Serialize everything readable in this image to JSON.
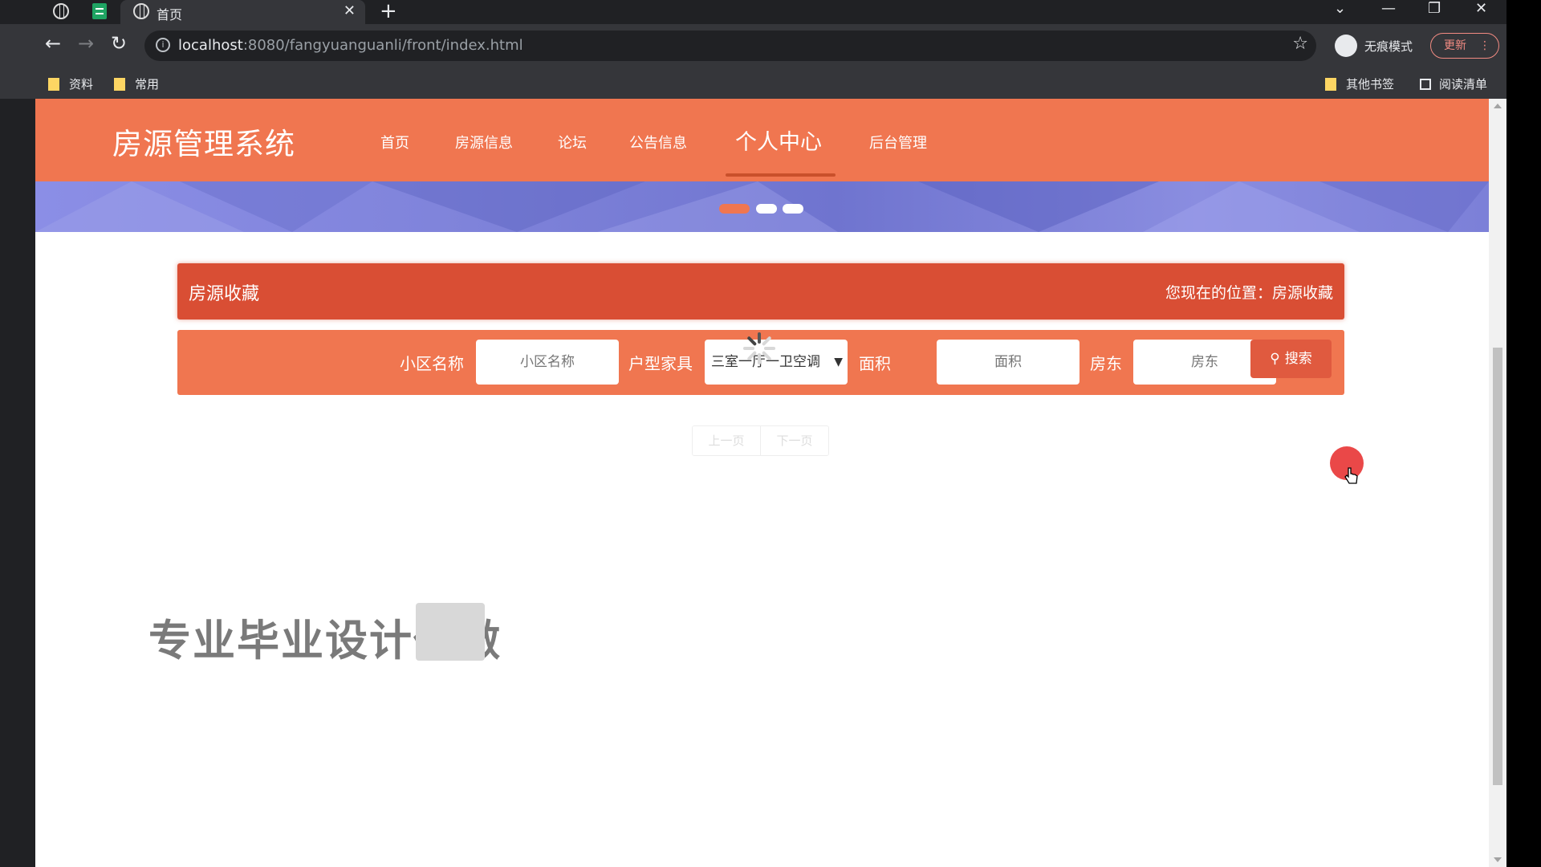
{
  "browser": {
    "tab_title": "首页",
    "tab_close": "✕",
    "new_tab": "+",
    "window_controls": [
      "⌄",
      "—",
      "❐",
      "✕"
    ],
    "url_host": "localhost",
    "url_rest": ":8080/fangyuanguanli/front/index.html",
    "incognito_label": "无痕模式",
    "update_label": "更新",
    "update_menu": "⋮",
    "bookmarks_left": [
      "资料",
      "常用"
    ],
    "bookmarks_right": [
      "其他书签",
      "阅读清单"
    ]
  },
  "site": {
    "logo": "房源管理系统",
    "nav": [
      "首页",
      "房源信息",
      "论坛",
      "公告信息",
      "个人中心",
      "后台管理"
    ],
    "active_nav": "个人中心",
    "colors": {
      "primary": "#f07650",
      "crumb": "#d94e34",
      "button": "#e05a3f"
    },
    "slider_dots": 3,
    "slider_active_index": 0
  },
  "crumb": {
    "title": "房源收藏",
    "location_label": "您现在的位置：",
    "location_value": "房源收藏"
  },
  "search": {
    "community_label": "小区名称",
    "community_placeholder": "小区名称",
    "layout_label": "户型家具",
    "layout_selected": "三室一厅一卫空调",
    "area_label": "面积",
    "area_placeholder": "面积",
    "landlord_label": "房东",
    "landlord_placeholder": "房东",
    "button_label": "搜索",
    "button_icon": "search-icon"
  },
  "pager": {
    "prev": "上一页",
    "next": "下一页"
  },
  "overlay": {
    "watermark": "专业毕业设计代做"
  }
}
